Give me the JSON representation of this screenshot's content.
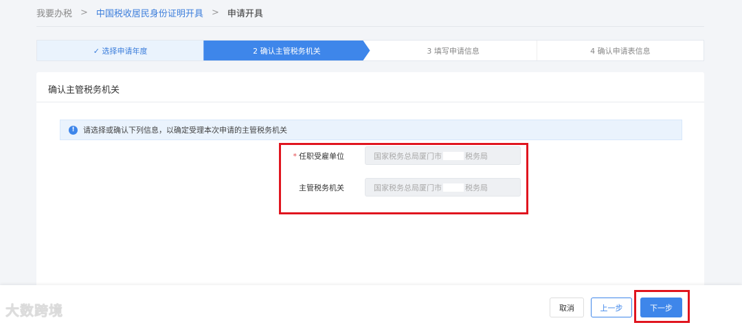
{
  "breadcrumb": {
    "home": "我要办税",
    "parent": "中国税收居民身份证明开具",
    "current": "申请开具",
    "separator": ">"
  },
  "steps": [
    {
      "label": "✓ 选择申请年度"
    },
    {
      "label": "2  确认主管税务机关"
    },
    {
      "label": "3  填写申请信息"
    },
    {
      "label": "4  确认申请表信息"
    }
  ],
  "card": {
    "title": "确认主管税务机关",
    "alert": "请选择或确认下列信息，以确定受理本次申请的主管税务机关",
    "alert_icon": "!"
  },
  "fields": [
    {
      "required": "*",
      "label": "任职受雇单位",
      "value_prefix": "国家税务总局厦门市",
      "value_suffix": "税务局"
    },
    {
      "label": "主管税务机关",
      "value_prefix": "国家税务总局厦门市",
      "value_suffix": "税务局"
    }
  ],
  "footer": {
    "cancel": "取消",
    "prev": "上一步",
    "next": "下一步",
    "watermark": "大数跨境"
  },
  "colors": {
    "primary": "#3e86ea",
    "highlight": "#e0141e"
  }
}
